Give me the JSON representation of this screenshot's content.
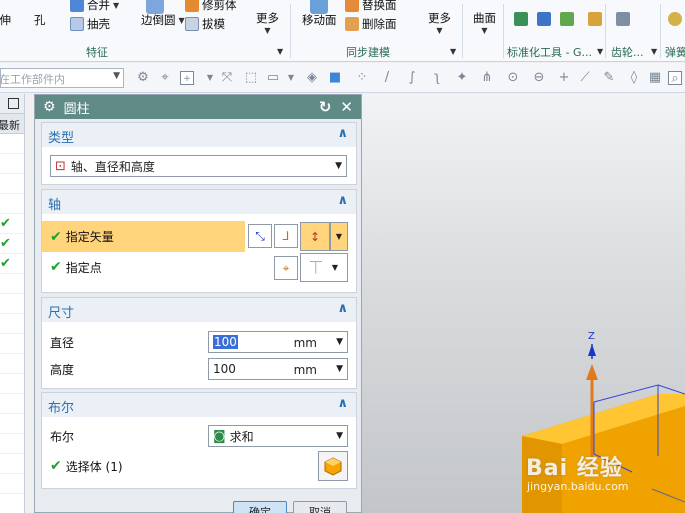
{
  "ribbon": {
    "buttons": {
      "stretch": "拉伸",
      "hole": "孔",
      "combine": "合并",
      "shell": "抽壳",
      "edge_blend": "边倒圆",
      "draft": "拔模",
      "trim_body": "修剪体",
      "more1": "更多",
      "move_face": "移动面",
      "replace_face": "替换面",
      "delete_face": "删除面",
      "more2": "更多",
      "curve": "曲面"
    },
    "groups": {
      "feature": "特征",
      "sync_modeling": "同步建模",
      "standard_tools": "标准化工具 - G...",
      "gear": "齿轮...",
      "spring": "弹簧"
    }
  },
  "toolbar2": {
    "filter_placeholder": "在工作部件内"
  },
  "navigator": {
    "column_label": "最新"
  },
  "dialog": {
    "title": "圆柱",
    "type_section": {
      "heading": "类型",
      "selected": "轴、直径和高度"
    },
    "axis_section": {
      "heading": "轴",
      "specify_vector": "指定矢量",
      "specify_point": "指定点"
    },
    "dimension_section": {
      "heading": "尺寸",
      "diameter_label": "直径",
      "diameter_value": "100",
      "diameter_unit": "mm",
      "height_label": "高度",
      "height_value": "100",
      "height_unit": "mm"
    },
    "boolean_section": {
      "heading": "布尔",
      "boolean_label": "布尔",
      "boolean_value": "求和",
      "select_body": "选择体 (1)"
    },
    "footer": {
      "ok": "确定",
      "cancel": "取消"
    }
  },
  "viewport": {
    "axis_z": "Z",
    "watermark": "Bai 经验",
    "watermark_sub": "jingyan.baidu.com"
  },
  "colors": {
    "dialog_title_bg": "#5f8a86",
    "section_heading": "#2c6fb0",
    "highlight": "#ffd47a",
    "solid_face": "#f5b400",
    "check_green": "#1fa12f",
    "axis_blue": "#1b36c4",
    "vector_orange": "#e07a1a"
  }
}
